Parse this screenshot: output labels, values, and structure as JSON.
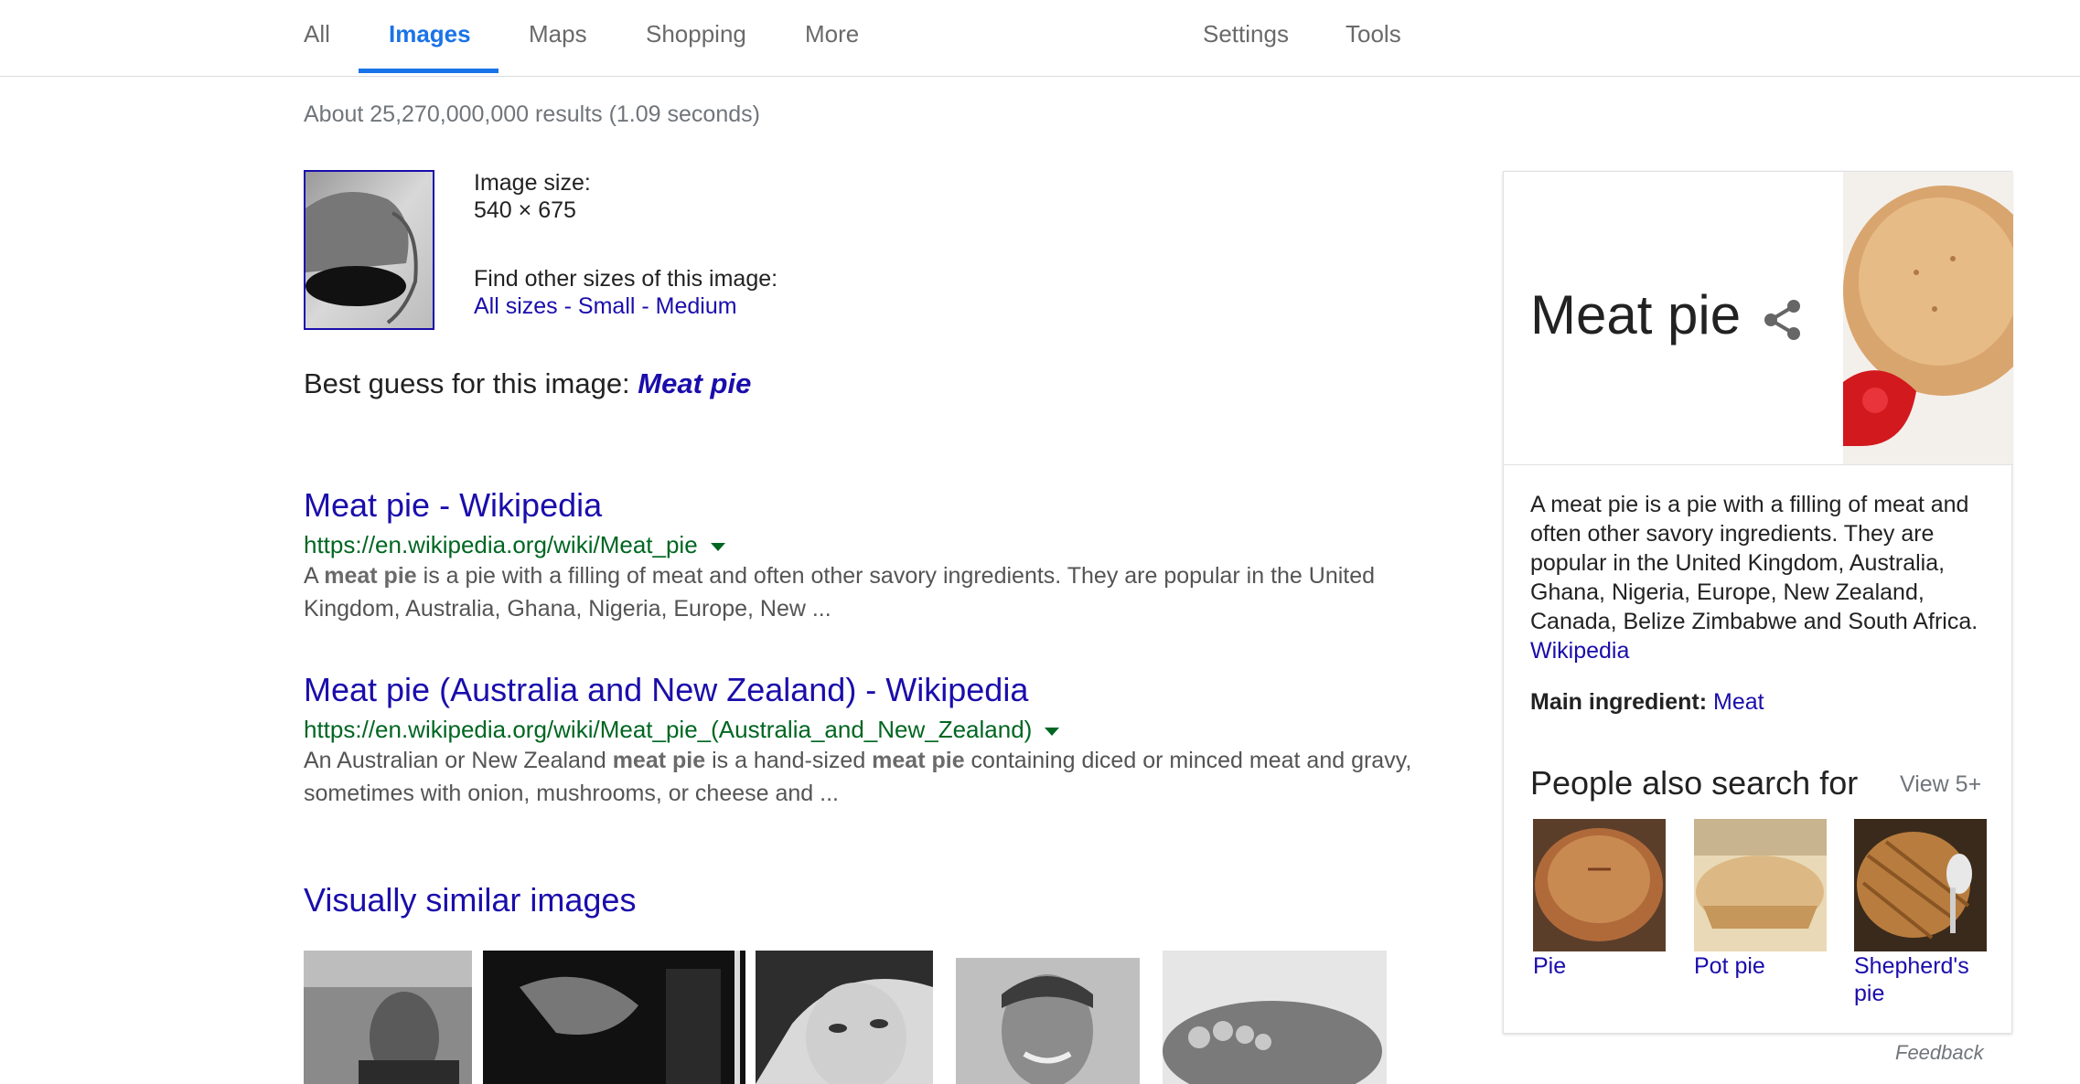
{
  "nav": {
    "tabs": [
      "All",
      "Images",
      "Maps",
      "Shopping",
      "More"
    ],
    "right": [
      "Settings",
      "Tools"
    ]
  },
  "stats": "About 25,270,000,000 results (1.09 seconds)",
  "query_image": {
    "size_label": "Image size:",
    "size_value": "540 × 675",
    "find_label": "Find other sizes of this image:",
    "all_sizes": "All sizes",
    "sep": "-",
    "small": "Small",
    "medium": "Medium"
  },
  "best_guess": {
    "label": "Best guess for this image:",
    "value": "Meat pie"
  },
  "results": [
    {
      "title": "Meat pie - Wikipedia",
      "url": "https://en.wikipedia.org/wiki/Meat_pie",
      "s1": "A ",
      "b1": "meat pie",
      "s2": " is a pie with a filling of meat and often other savory ingredients. They are popular in the United Kingdom, Australia, Ghana, Nigeria, Europe, New ..."
    },
    {
      "title": "Meat pie (Australia and New Zealand) - Wikipedia",
      "url": "https://en.wikipedia.org/wiki/Meat_pie_(Australia_and_New_Zealand)",
      "s1": "An Australian or New Zealand ",
      "b1": "meat pie",
      "s2": " is a hand-sized ",
      "b2": "meat pie",
      "s3": " containing diced or minced meat and gravy, sometimes with onion, mushrooms, or cheese and ..."
    }
  ],
  "similar_heading": "Visually similar images",
  "knowledge_panel": {
    "title": "Meat pie",
    "description": "A meat pie is a pie with a filling of meat and often other savory ingredients. They are popular in the United Kingdom, Australia, Ghana, Nigeria, Europe, New Zealand, Canada, Belize Zimbabwe and South Africa.",
    "source": "Wikipedia",
    "ingredient_label": "Main ingredient:",
    "ingredient_value": "Meat",
    "psf_heading": "People also search for",
    "view_more": "View 5+",
    "psf": [
      {
        "label": "Pie"
      },
      {
        "label": "Pot pie"
      },
      {
        "label": "Shepherd's pie"
      }
    ],
    "feedback": "Feedback"
  },
  "colors": {
    "accent": "#1a73e8",
    "link": "#1a0dab",
    "url": "#006621"
  }
}
